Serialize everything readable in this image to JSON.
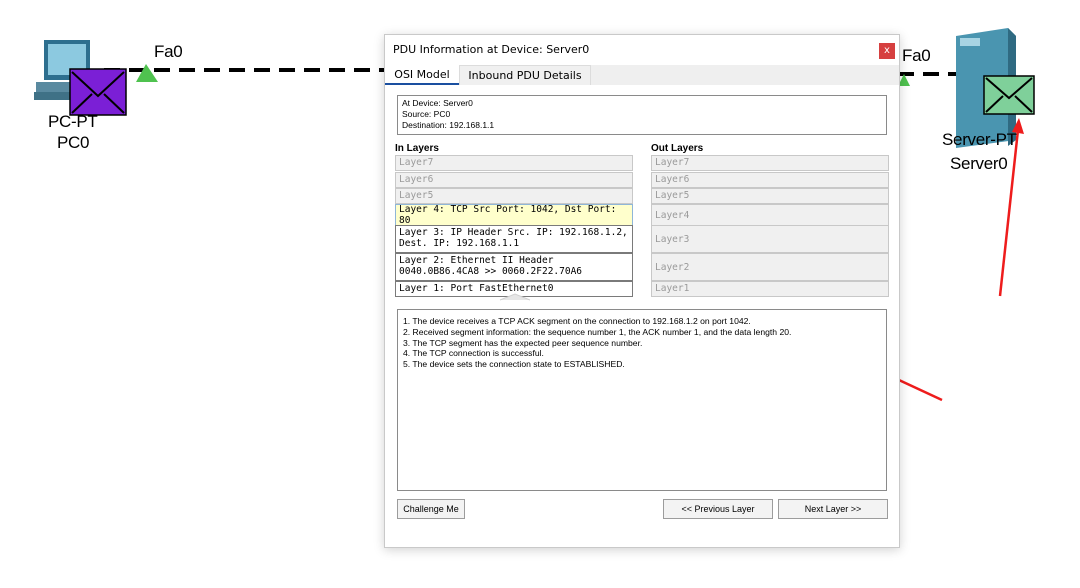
{
  "canvas": {
    "pc": {
      "interface": "Fa0",
      "model": "PC-PT",
      "name": "PC0"
    },
    "server": {
      "interface": "Fa0",
      "model": "Server-PT",
      "name": "Server0"
    },
    "pdu_envelope_pc_color": "#7b1fd6",
    "pdu_envelope_server_color": "#7fd09a",
    "annotation_arrow_color": "#ee1c1c",
    "link_up_indicator_color": "#4fc24f"
  },
  "dialog": {
    "title": "PDU Information at Device: Server0",
    "close_label": "x",
    "tabs": [
      {
        "label": "OSI Model",
        "active": true
      },
      {
        "label": "Inbound PDU Details",
        "active": false
      }
    ],
    "info": {
      "device": "At Device: Server0",
      "source": "Source: PC0",
      "destination": "Destination: 192.168.1.1"
    },
    "in_layers_header": "In Layers",
    "out_layers_header": "Out Layers",
    "in_layers": [
      "Layer7",
      "Layer6",
      "Layer5",
      "Layer 4: TCP Src Port: 1042, Dst Port: 80",
      "Layer 3: IP Header Src. IP: 192.168.1.2, Dest. IP: 192.168.1.1",
      "Layer 2: Ethernet II Header 0040.0B86.4CA8 >> 0060.2F22.70A6",
      "Layer 1: Port FastEthernet0"
    ],
    "in_layers_line1": {
      "l3": "Layer 3: IP Header Src. IP: 192.168.1.2,",
      "l3b": "Dest. IP: 192.168.1.1",
      "l2": "Layer 2: Ethernet II Header",
      "l2b": "0040.0B86.4CA8 >> 0060.2F22.70A6"
    },
    "out_layers": [
      "Layer7",
      "Layer6",
      "Layer5",
      "Layer4",
      "Layer3",
      "Layer2",
      "Layer1"
    ],
    "description": [
      "1. The device receives a TCP ACK segment on the connection to 192.168.1.2 on port 1042.",
      "2. Received segment information: the sequence number 1, the ACK number 1, and the data length 20.",
      "3. The TCP segment has the expected peer sequence number.",
      "4. The TCP connection is successful.",
      "5. The device sets the connection state to ESTABLISHED."
    ],
    "buttons": {
      "challenge": "Challenge Me",
      "previous": "<< Previous Layer",
      "next": "Next Layer >>"
    }
  }
}
